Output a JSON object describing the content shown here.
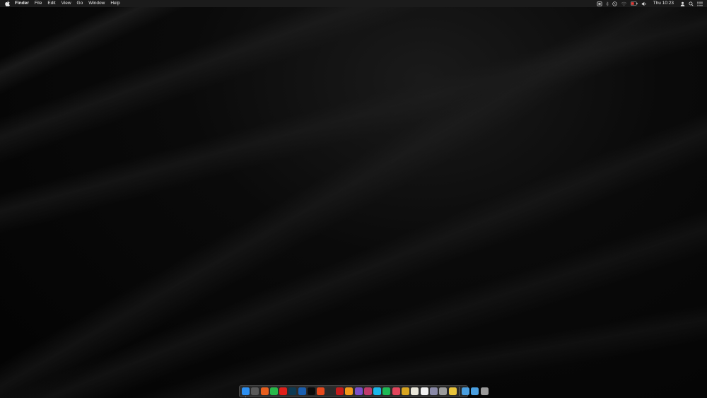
{
  "menubar": {
    "app_name": "Finder",
    "menus": [
      "File",
      "Edit",
      "View",
      "Go",
      "Window",
      "Help"
    ],
    "clock": "Thu 10:23"
  },
  "status_icons": [
    "dropbox-icon",
    "bluetooth-icon",
    "time-machine-icon",
    "wifi-icon",
    "battery-icon",
    "volume-icon",
    "user-icon",
    "spotlight-icon",
    "notification-center-icon"
  ],
  "dock": {
    "apps": [
      {
        "name": "finder-icon",
        "color": "#2d8ff0",
        "running": true
      },
      {
        "name": "launchpad-icon",
        "color": "#5a5a5a"
      },
      {
        "name": "firefox-icon",
        "color": "#e85f1f"
      },
      {
        "name": "whatsapp-icon",
        "color": "#28b84a"
      },
      {
        "name": "youtube-icon",
        "color": "#e0201a"
      },
      {
        "name": "mubi-icon",
        "color": "#0e3a52"
      },
      {
        "name": "prime-video-icon",
        "color": "#1a5fb0"
      },
      {
        "name": "netflix-icon",
        "color": "#0b0b0b"
      },
      {
        "name": "app-orange-icon",
        "color": "#e84a1c"
      },
      {
        "name": "hbo-icon",
        "color": "#2a2a2a"
      },
      {
        "name": "netflix-red-icon",
        "color": "#c51b1b"
      },
      {
        "name": "vlc-icon",
        "color": "#f29a1a"
      },
      {
        "name": "app-purple-icon",
        "color": "#7b4fc8"
      },
      {
        "name": "app-multicolor-icon",
        "color": "#c03a6a"
      },
      {
        "name": "vimeo-icon",
        "color": "#1ab7ea"
      },
      {
        "name": "spotify-icon",
        "color": "#1db954"
      },
      {
        "name": "app-pink-icon",
        "color": "#e2455c"
      },
      {
        "name": "chrome-icon",
        "color": "#d8a520"
      },
      {
        "name": "notes-icon",
        "color": "#e9e6d9"
      },
      {
        "name": "textedit-icon",
        "color": "#f1f1f1"
      },
      {
        "name": "preview-icon",
        "color": "#8a8aa8"
      },
      {
        "name": "system-preferences-icon",
        "color": "#9c9c9c"
      },
      {
        "name": "app-yellow-icon",
        "color": "#e8c33a"
      }
    ],
    "folders": [
      {
        "name": "downloads-folder-icon",
        "color": "#4a9fe0"
      },
      {
        "name": "documents-folder-icon",
        "color": "#4a9fe0"
      },
      {
        "name": "trash-icon",
        "color": "#9a9a9a"
      }
    ]
  }
}
